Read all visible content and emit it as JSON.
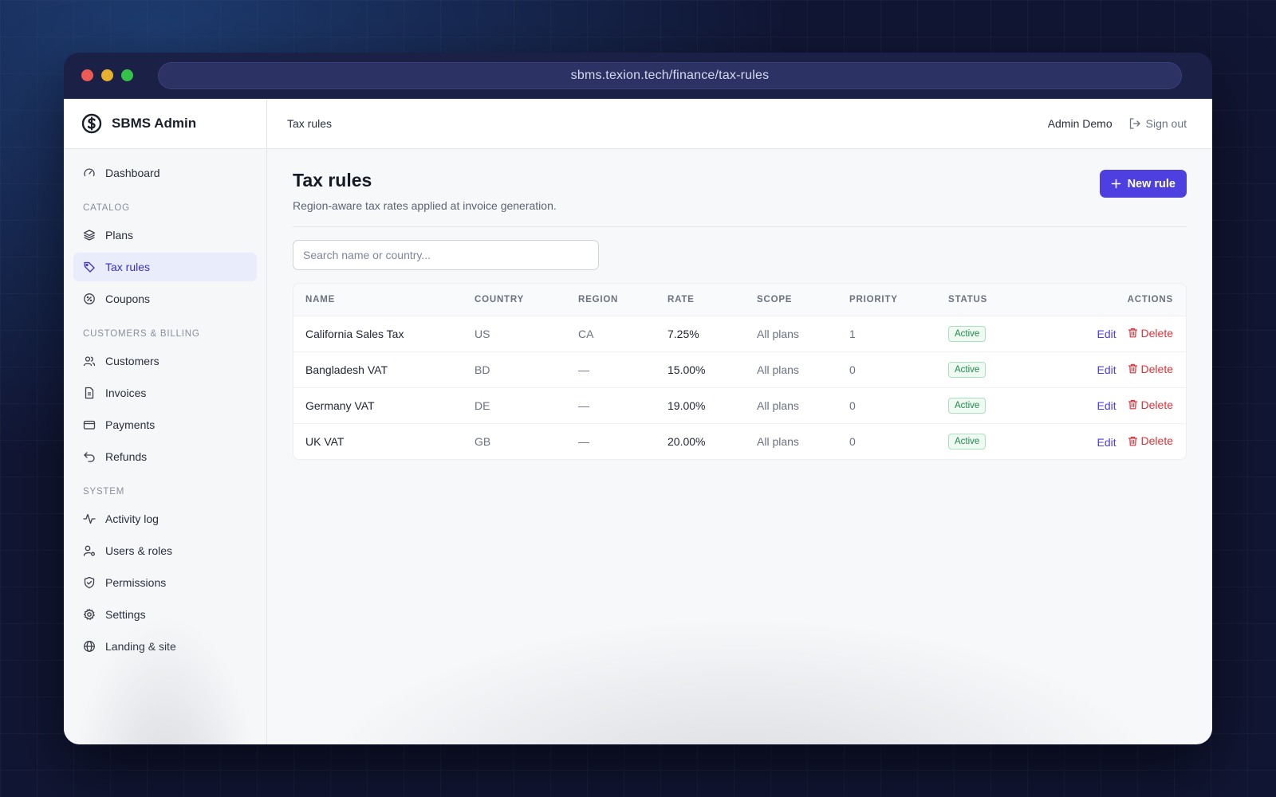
{
  "browser": {
    "url": "sbms.texion.tech/finance/tax-rules"
  },
  "brand": {
    "name": "SBMS Admin",
    "logo_icon": "sbms-logo-icon"
  },
  "sidebar": {
    "dashboard": "Dashboard",
    "sections": {
      "catalog": "CATALOG",
      "customers_billing": "CUSTOMERS & BILLING",
      "system": "SYSTEM"
    },
    "items": [
      {
        "label": "Plans",
        "icon": "layers-icon"
      },
      {
        "label": "Tax rules",
        "icon": "tag-icon"
      },
      {
        "label": "Coupons",
        "icon": "coupon-icon"
      },
      {
        "label": "Customers",
        "icon": "users-icon"
      },
      {
        "label": "Invoices",
        "icon": "file-icon"
      },
      {
        "label": "Payments",
        "icon": "card-icon"
      },
      {
        "label": "Refunds",
        "icon": "undo-icon"
      },
      {
        "label": "Activity log",
        "icon": "activity-icon"
      },
      {
        "label": "Users & roles",
        "icon": "user-gear-icon"
      },
      {
        "label": "Permissions",
        "icon": "shield-check-icon"
      },
      {
        "label": "Settings",
        "icon": "gear-icon"
      },
      {
        "label": "Landing & site",
        "icon": "globe-icon"
      }
    ],
    "active": "Tax rules"
  },
  "topbar": {
    "breadcrumb": "Tax rules",
    "user_name": "Admin Demo",
    "signout_label": "Sign out"
  },
  "page": {
    "title": "Tax rules",
    "subtitle": "Region-aware tax rates applied at invoice generation.",
    "new_button": "New rule",
    "search_placeholder": "Search name or country...",
    "search_value": ""
  },
  "table": {
    "headers": {
      "name": "NAME",
      "country": "COUNTRY",
      "region": "REGION",
      "rate": "RATE",
      "scope": "SCOPE",
      "priority": "PRIORITY",
      "status": "STATUS",
      "actions": "ACTIONS"
    },
    "rows": [
      {
        "name": "California Sales Tax",
        "country": "US",
        "region": "CA",
        "rate": "7.25%",
        "scope": "All plans",
        "priority": "1",
        "status": "Active",
        "edit": "Edit",
        "delete": "Delete"
      },
      {
        "name": "Bangladesh VAT",
        "country": "BD",
        "region": "—",
        "rate": "15.00%",
        "scope": "All plans",
        "priority": "0",
        "status": "Active",
        "edit": "Edit",
        "delete": "Delete"
      },
      {
        "name": "Germany VAT",
        "country": "DE",
        "region": "—",
        "rate": "19.00%",
        "scope": "All plans",
        "priority": "0",
        "status": "Active",
        "edit": "Edit",
        "delete": "Delete"
      },
      {
        "name": "UK VAT",
        "country": "GB",
        "region": "—",
        "rate": "20.00%",
        "scope": "All plans",
        "priority": "0",
        "status": "Active",
        "edit": "Edit",
        "delete": "Delete"
      }
    ]
  },
  "colors": {
    "accent": "#4e40e0",
    "active_nav_bg": "#e8ecfb",
    "status_green": "#1f8a4a",
    "danger": "#d9333a"
  }
}
